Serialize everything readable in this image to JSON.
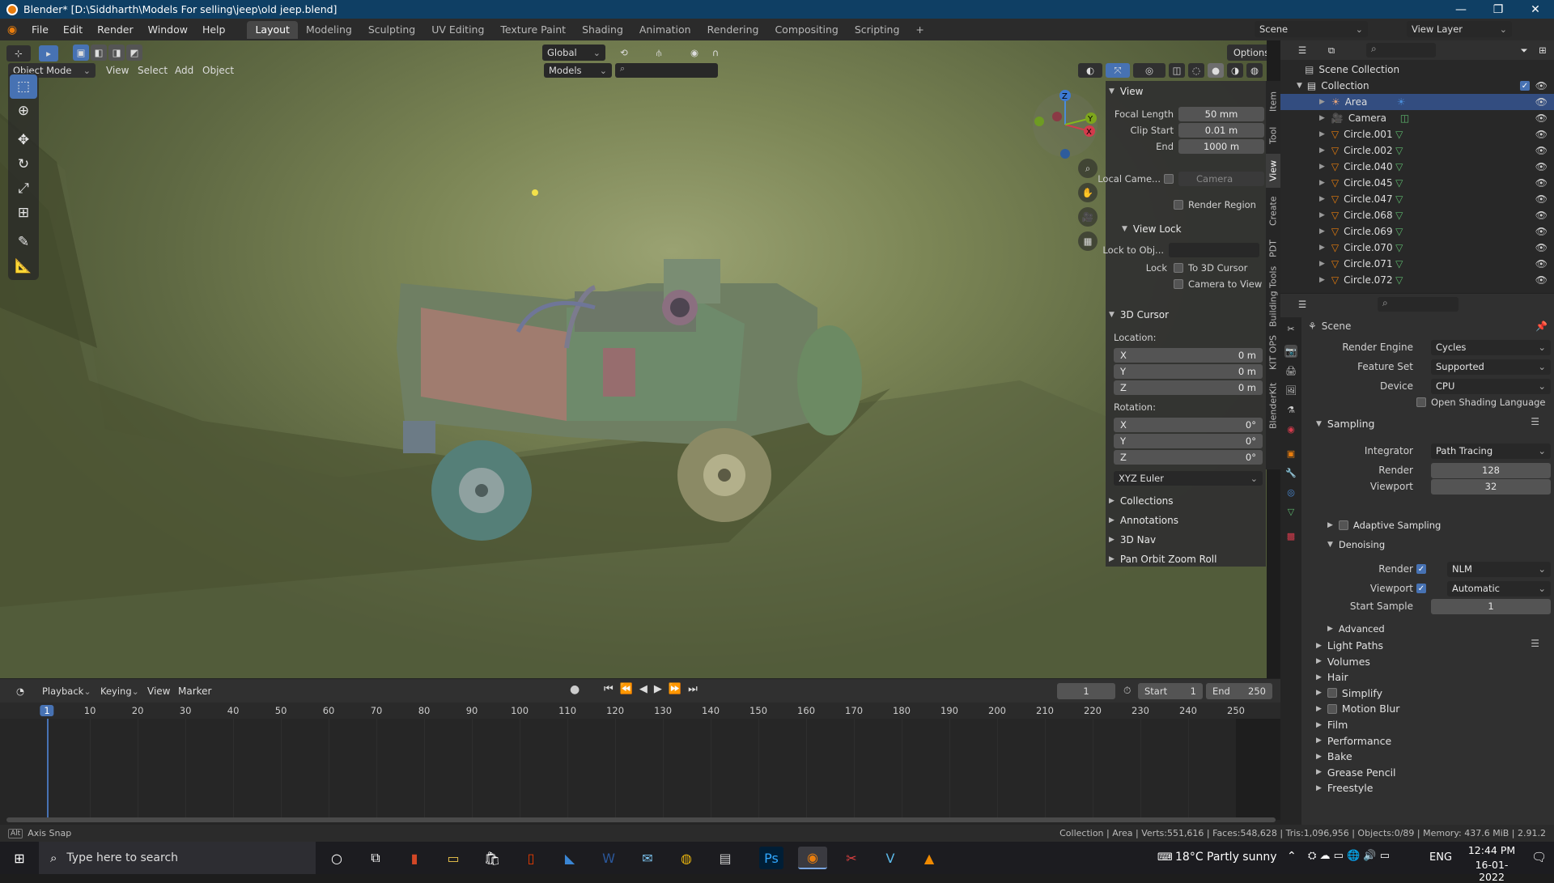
{
  "window": {
    "title": "Blender* [D:\\Siddharth\\Models For selling\\jeep\\old jeep.blend]",
    "minimize": "—",
    "maximize": "❐",
    "close": "✕"
  },
  "menus": [
    "File",
    "Edit",
    "Render",
    "Window",
    "Help"
  ],
  "workspaces": [
    "Layout",
    "Modeling",
    "Sculpting",
    "UV Editing",
    "Texture Paint",
    "Shading",
    "Animation",
    "Rendering",
    "Compositing",
    "Scripting"
  ],
  "workspace_add": "+",
  "scene_selector": {
    "scene": "Scene",
    "view_layer": "View Layer"
  },
  "viewport": {
    "mode": "Object Mode",
    "header_menus": [
      "View",
      "Select",
      "Add",
      "Object"
    ],
    "orientation": "Global",
    "models_dropdown": "Models",
    "options": "Options",
    "gizmo": {
      "x": "X",
      "y": "Y",
      "z": "Z"
    }
  },
  "npanel": {
    "view_header": "View",
    "focal_length": {
      "label": "Focal Length",
      "value": "50 mm"
    },
    "clip_start": {
      "label": "Clip Start",
      "value": "0.01 m"
    },
    "clip_end": {
      "label": "End",
      "value": "1000 m"
    },
    "local_camera": {
      "label": "Local Came...",
      "value": "Camera"
    },
    "render_region": "Render Region",
    "view_lock_header": "View Lock",
    "lock_to_obj": "Lock to Obj...",
    "lock_label": "Lock",
    "to_3d_cursor": "To 3D Cursor",
    "camera_to_view": "Camera to View",
    "cursor_header": "3D Cursor",
    "location_label": "Location:",
    "location": [
      {
        "axis": "X",
        "value": "0 m"
      },
      {
        "axis": "Y",
        "value": "0 m"
      },
      {
        "axis": "Z",
        "value": "0 m"
      }
    ],
    "rotation_label": "Rotation:",
    "rotation": [
      {
        "axis": "X",
        "value": "0°"
      },
      {
        "axis": "Y",
        "value": "0°"
      },
      {
        "axis": "Z",
        "value": "0°"
      }
    ],
    "rotation_mode": "XYZ Euler",
    "collapsed": [
      "Collections",
      "Annotations",
      "3D Nav",
      "Pan Orbit Zoom Roll"
    ],
    "tabs": [
      "Item",
      "Tool",
      "View",
      "Create",
      "PDT",
      "Building Tools",
      "KIT OPS",
      "BlenderKit"
    ]
  },
  "outliner": {
    "root": "Scene Collection",
    "collection": "Collection",
    "items": [
      "Area",
      "Camera",
      "Circle.001",
      "Circle.002",
      "Circle.040",
      "Circle.045",
      "Circle.047",
      "Circle.068",
      "Circle.069",
      "Circle.070",
      "Circle.071",
      "Circle.072"
    ]
  },
  "properties": {
    "scene_label": "Scene",
    "render_engine": {
      "label": "Render Engine",
      "value": "Cycles"
    },
    "feature_set": {
      "label": "Feature Set",
      "value": "Supported"
    },
    "device": {
      "label": "Device",
      "value": "CPU"
    },
    "osl": "Open Shading Language",
    "sampling_header": "Sampling",
    "integrator": {
      "label": "Integrator",
      "value": "Path Tracing"
    },
    "render_samples": {
      "label": "Render",
      "value": "128"
    },
    "viewport_samples": {
      "label": "Viewport",
      "value": "32"
    },
    "adaptive_sampling": "Adaptive Sampling",
    "denoising_header": "Denoising",
    "denoise_render": {
      "label": "Render",
      "value": "NLM"
    },
    "denoise_viewport": {
      "label": "Viewport",
      "value": "Automatic"
    },
    "start_sample": {
      "label": "Start Sample",
      "value": "1"
    },
    "advanced": "Advanced",
    "sections": [
      "Light Paths",
      "Volumes",
      "Hair",
      "Simplify",
      "Motion Blur",
      "Film",
      "Performance",
      "Bake",
      "Grease Pencil",
      "Freestyle"
    ]
  },
  "timeline": {
    "menus": [
      "Playback",
      "Keying",
      "View",
      "Marker"
    ],
    "current_frame": "1",
    "start_label": "Start",
    "start": "1",
    "end_label": "End",
    "end": "250",
    "ruler": [
      "1",
      "10",
      "20",
      "30",
      "40",
      "50",
      "60",
      "70",
      "80",
      "90",
      "100",
      "110",
      "120",
      "130",
      "140",
      "150",
      "160",
      "170",
      "180",
      "190",
      "200",
      "210",
      "220",
      "230",
      "240",
      "250"
    ]
  },
  "status": {
    "left": "Axis Snap",
    "right": "Collection | Area | Verts:551,616 | Faces:548,628 | Tris:1,096,956 | Objects:0/89 | Memory: 437.6 MiB | 2.91.2"
  },
  "taskbar": {
    "search_placeholder": "Type here to search",
    "weather": "18°C  Partly sunny",
    "language": "ENG",
    "time": "12:44 PM",
    "date": "16-01-2022"
  },
  "colors": {
    "accent": "#4772b3",
    "selected_row": "#334d80",
    "title_bar": "#0f3f64",
    "blender_orange": "#e87d0d"
  }
}
